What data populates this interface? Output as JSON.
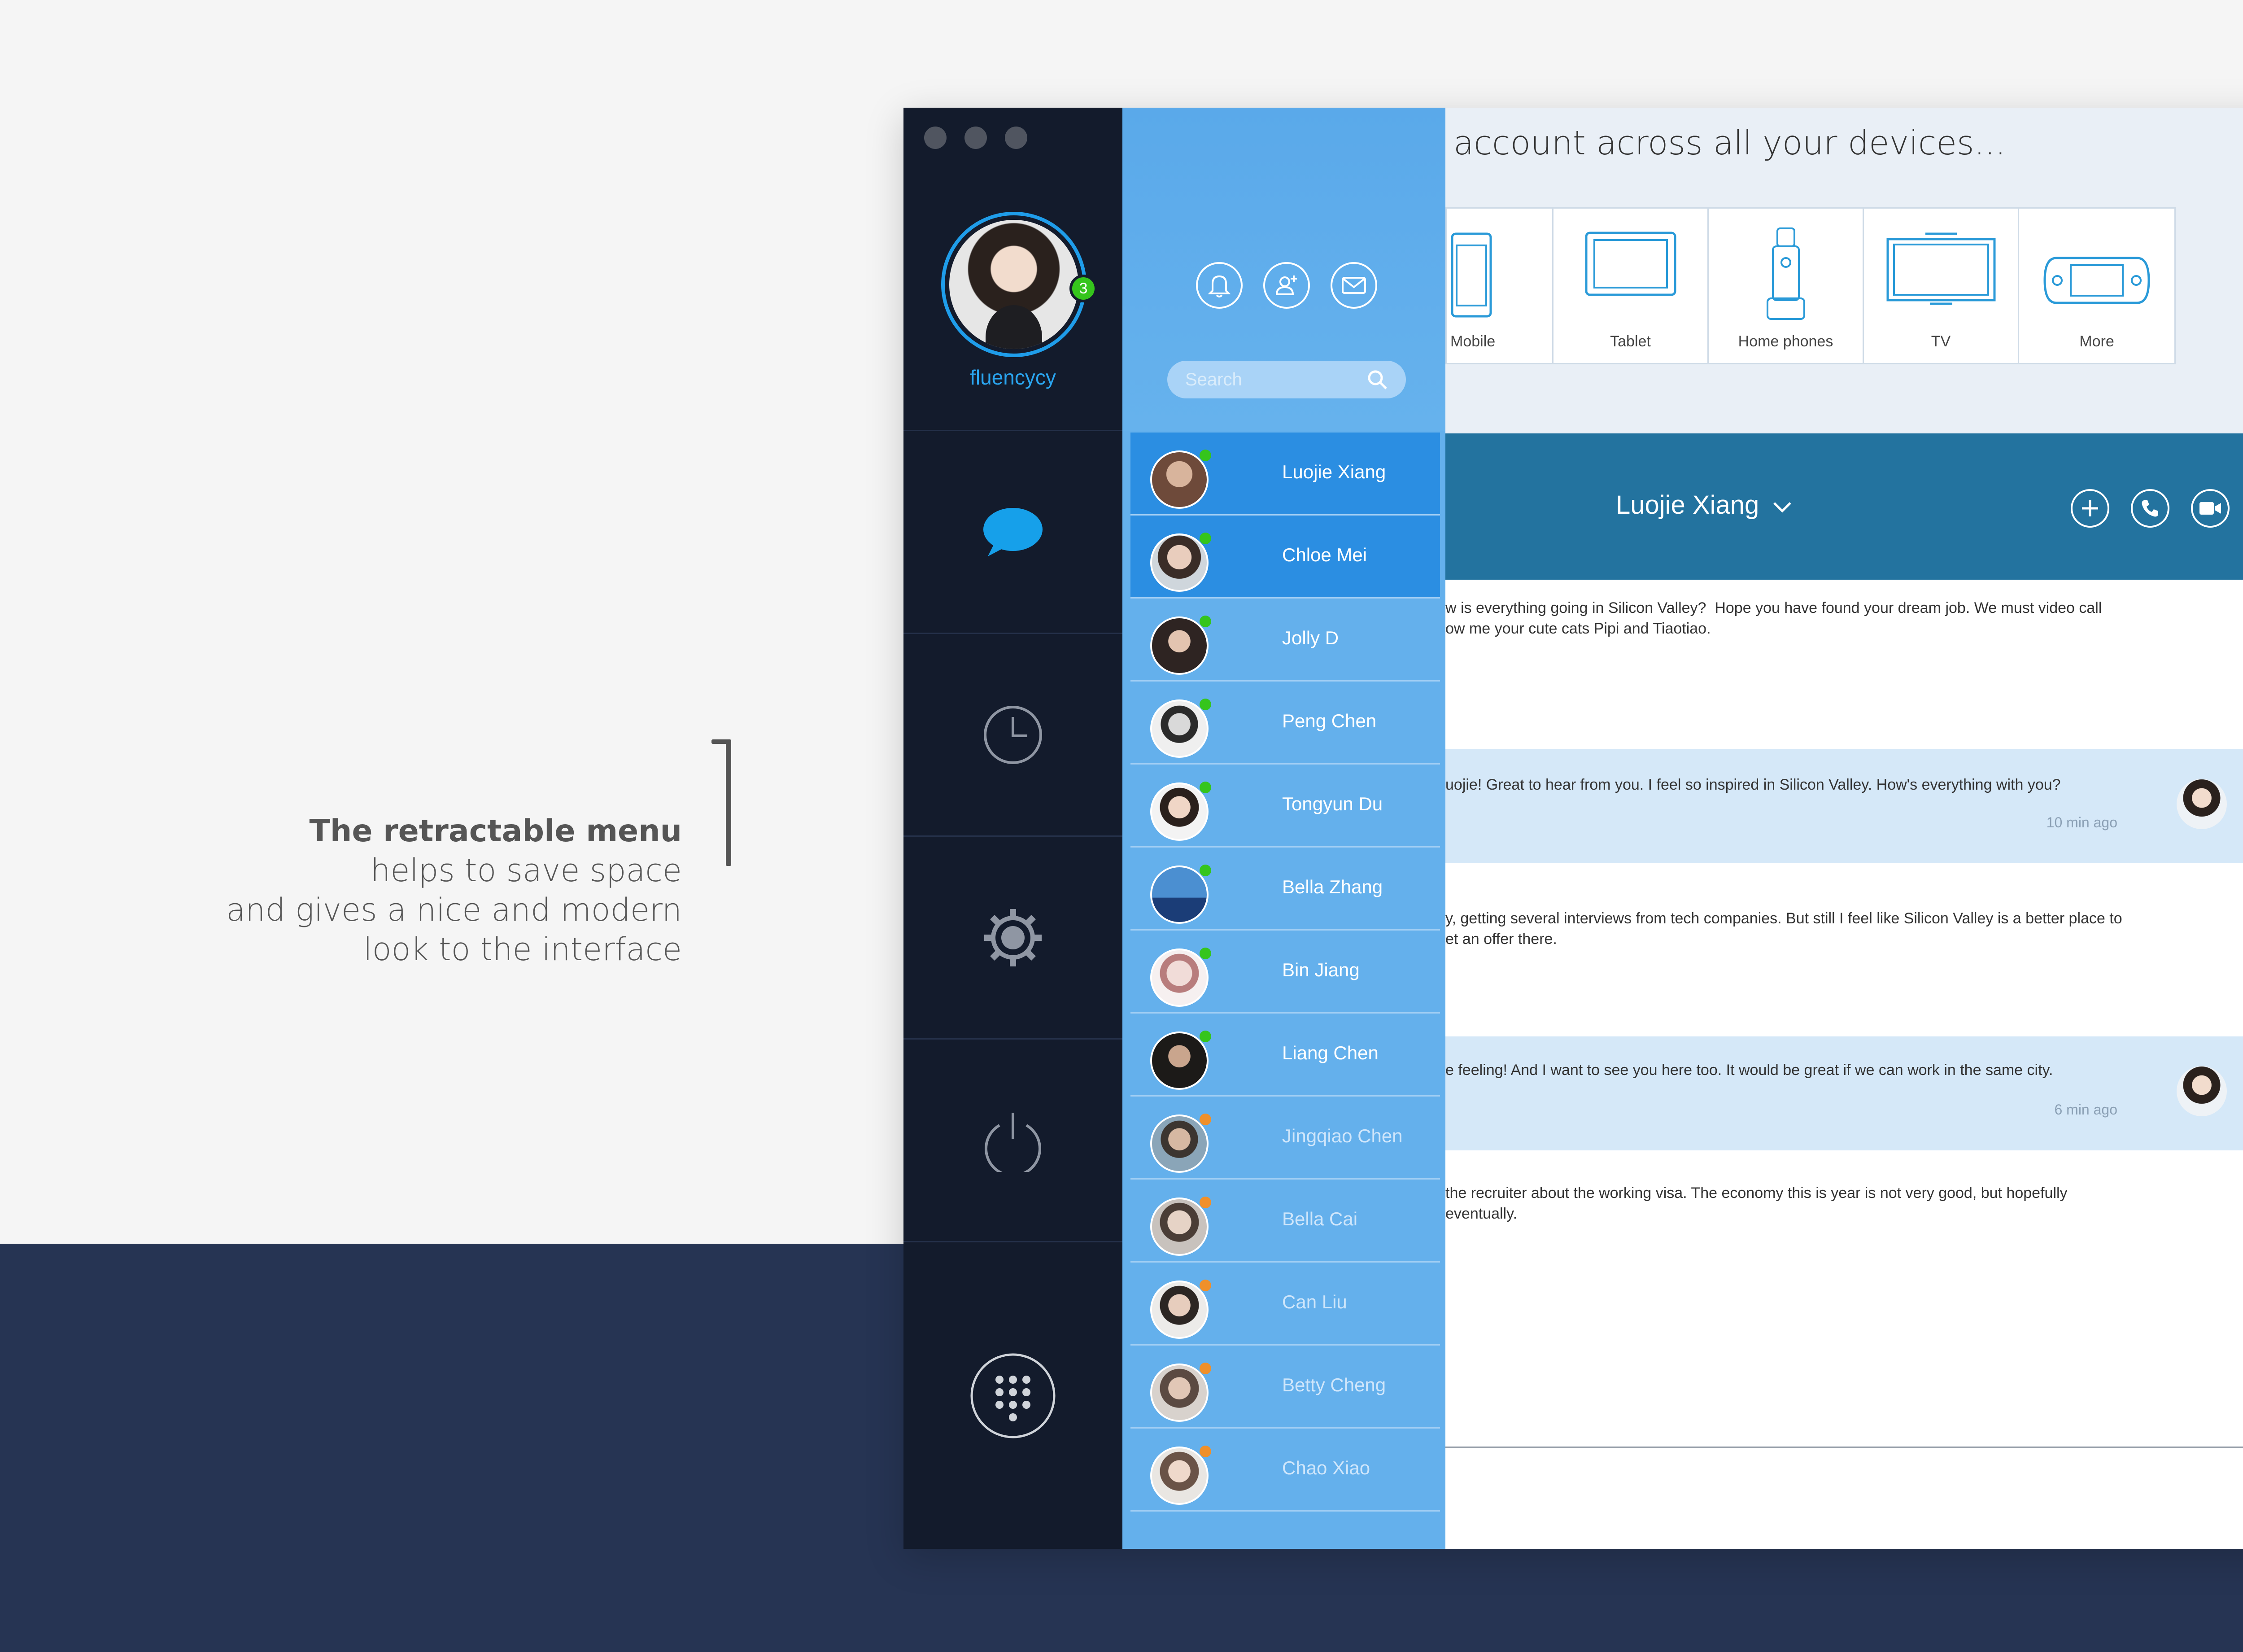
{
  "caption": {
    "title": "The retractable menu",
    "lines": [
      "helps to save space",
      "and gives a nice and modern",
      "look to the interface"
    ]
  },
  "profile": {
    "username": "fluencycy",
    "badge": "3"
  },
  "rail": {
    "items": [
      "chat-icon",
      "clock-icon",
      "settings-icon",
      "power-icon",
      "dialpad-icon"
    ],
    "active": "chat-icon"
  },
  "contacts": {
    "search_placeholder": "Search",
    "header_buttons": [
      "bell-icon",
      "add-contact-icon",
      "mail-icon"
    ],
    "list": [
      {
        "name": "Luojie Xiang",
        "status": "online"
      },
      {
        "name": "Chloe Mei",
        "status": "online"
      },
      {
        "name": "Jolly D",
        "status": "online"
      },
      {
        "name": "Peng Chen",
        "status": "online"
      },
      {
        "name": "Tongyun Du",
        "status": "online"
      },
      {
        "name": "Bella Zhang",
        "status": "online"
      },
      {
        "name": "Bin Jiang",
        "status": "online"
      },
      {
        "name": "Liang Chen",
        "status": "online"
      },
      {
        "name": "Jingqiao Chen",
        "status": "away"
      },
      {
        "name": "Bella Cai",
        "status": "away"
      },
      {
        "name": "Can Liu",
        "status": "away"
      },
      {
        "name": "Betty Cheng",
        "status": "away"
      },
      {
        "name": "Chao Xiao",
        "status": "away"
      }
    ]
  },
  "devices": {
    "title": "account across all your devices...",
    "items": [
      "Mobile",
      "Tablet",
      "Home phones",
      "TV",
      "More"
    ]
  },
  "chat": {
    "contact_name": "Luojie Xiang",
    "actions": [
      "add-icon",
      "phone-icon",
      "video-icon"
    ],
    "messages": [
      {
        "dir": "in",
        "text": "w is everything going in Silicon Valley?  Hope you have found your dream job. We must video call\now me your cute cats Pipi and Tiaotiao.",
        "time": ""
      },
      {
        "dir": "out",
        "text": "uojie! Great to hear from you. I feel so inspired in Silicon Valley. How's everything with you?",
        "time": "10 min ago"
      },
      {
        "dir": "in",
        "text": "y, getting several interviews from tech companies. But still I feel like Silicon Valley is a better place to\net an offer there.",
        "time": ""
      },
      {
        "dir": "out",
        "text": "e feeling! And I want to see you here too. It would be great if we can work in the same city.",
        "time": "6 min ago"
      },
      {
        "dir": "in",
        "text": "the recruiter about the working visa. The economy this is year is not very good, but hopefully\neventually.",
        "time": ""
      }
    ]
  },
  "colors": {
    "rail_bg": "#131b2c",
    "contacts_bg": "#64b0ec",
    "active_contact": "#2b8ee2",
    "chat_header": "#23739f",
    "online": "#35c51c",
    "away": "#f0902a",
    "page_dark": "#263453"
  }
}
